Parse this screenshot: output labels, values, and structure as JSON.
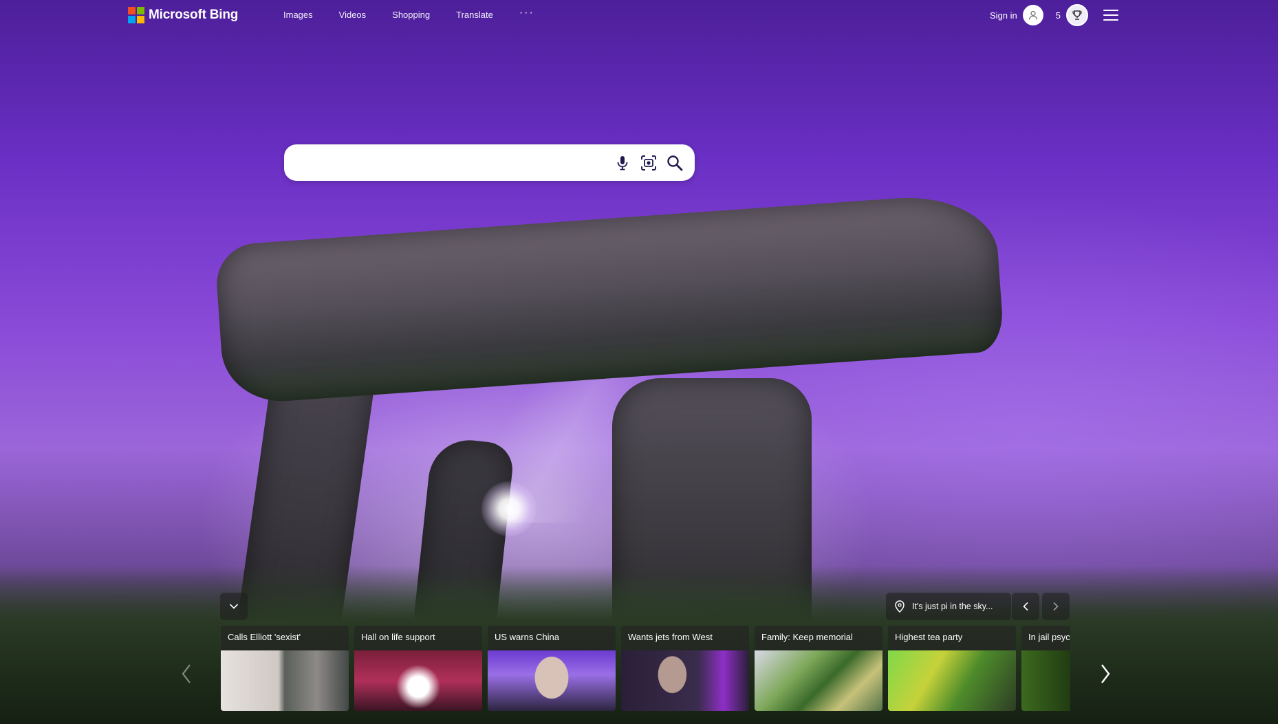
{
  "header": {
    "brand": "Microsoft Bing",
    "nav": [
      "Images",
      "Videos",
      "Shopping",
      "Translate"
    ],
    "more_label": "···",
    "sign_in": "Sign in",
    "reward_points": "5"
  },
  "search": {
    "value": "",
    "placeholder": ""
  },
  "location": {
    "text": "It's just pi in the sky..."
  },
  "news": [
    {
      "title": "Calls Elliott 'sexist'"
    },
    {
      "title": "Hall on life support"
    },
    {
      "title": "US warns China"
    },
    {
      "title": "Wants jets from West"
    },
    {
      "title": "Family: Keep memorial"
    },
    {
      "title": "Highest tea party"
    },
    {
      "title": "In jail psyc"
    }
  ],
  "colors": {
    "logo_red": "#f25022",
    "logo_green": "#7fba00",
    "logo_blue": "#00a4ef",
    "logo_yellow": "#ffb900",
    "search_icon": "#1e1a4f"
  },
  "icons": {
    "mic": "microphone-icon",
    "visual_search": "visual-search-icon",
    "search": "search-icon",
    "location": "location-pin-icon"
  }
}
